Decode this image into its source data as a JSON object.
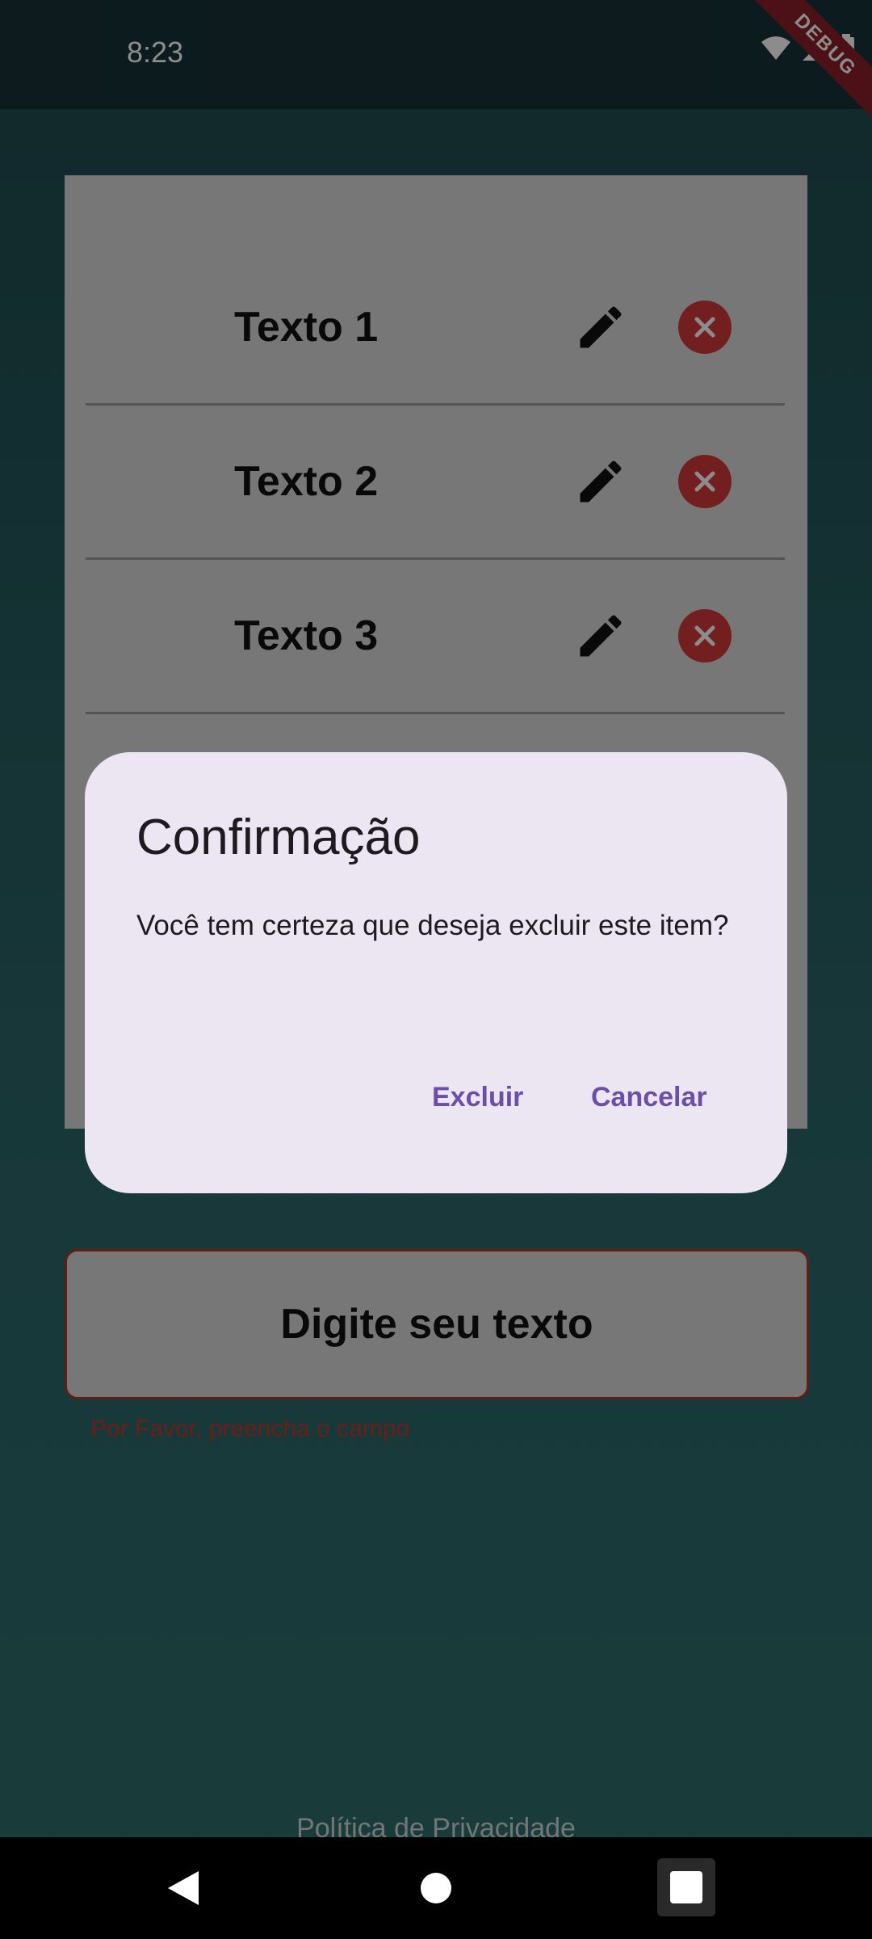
{
  "status_bar": {
    "time": "8:23",
    "debug_banner": "DEBUG"
  },
  "list": {
    "items": [
      {
        "label": "Texto 1"
      },
      {
        "label": "Texto 2"
      },
      {
        "label": "Texto 3"
      }
    ]
  },
  "input": {
    "placeholder": "Digite seu texto",
    "error": "Por Favor, preencha o campo"
  },
  "footer": {
    "policy_link": "Política de Privacidade"
  },
  "dialog": {
    "title": "Confirmação",
    "message": "Você tem certeza que deseja excluir este item?",
    "confirm_label": "Excluir",
    "cancel_label": "Cancelar"
  },
  "colors": {
    "accent": "#6a4fa8",
    "delete": "#d33a3a",
    "dialog_bg": "#ece6f2",
    "error": "#c0392b"
  }
}
